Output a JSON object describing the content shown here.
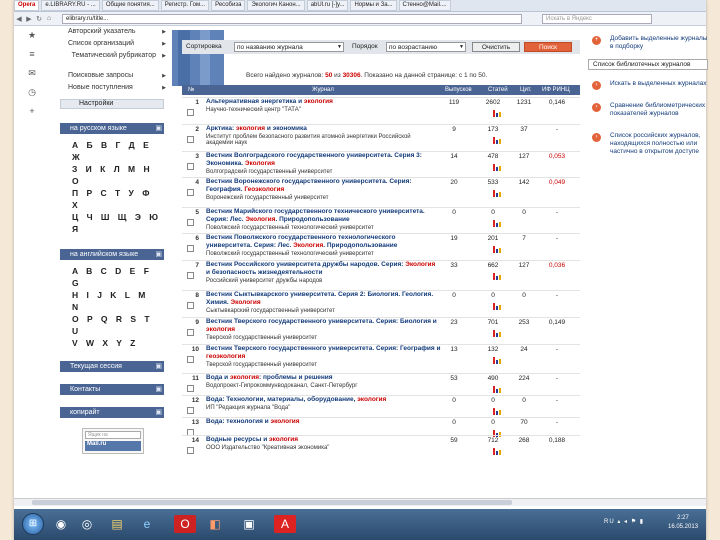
{
  "browser": {
    "tabs": [
      "Opera",
      "e.LIBRARY.RU - ...",
      "Общие понятия...",
      "Регистр. Гом...",
      "Ресобиза",
      "Экологич Канон...",
      "abUl.ru [-]у...",
      "Нормы и За...",
      "Стенно@Mail...."
    ],
    "url": "elibrary.ru/title...",
    "search_placeholder": "Искать в Яндекс"
  },
  "left_menu": {
    "items": [
      "Авторский указатель",
      "Список организаций",
      "Тематический рубрикатор",
      "Поисковые запросы",
      "Новые поступления"
    ],
    "settings": "Настройки",
    "russian_header": "на русском языке",
    "russian_letters": [
      "А Б В Г Д Е Ж",
      "З И К Л М Н О",
      "П Р С Т У Ф Х",
      "Ц Ч Ш Щ Э Ю Я"
    ],
    "english_header": "на английском языке",
    "english_letters": [
      "A B C D E F G",
      "H I J K L M N",
      "O P Q R S T U",
      "V W X Y Z"
    ],
    "current_session": "Текущая сессия",
    "contacts": "Контакты",
    "copyright": "копирайт",
    "mail_placeholder": "Ящик на",
    "mail_logo": "Mail.ru"
  },
  "sort_bar": {
    "sort_label": "Сортировка",
    "sort_value": "по названию журнала",
    "order_label": "Порядок",
    "order_value": "по возрастанию",
    "clear_button": "Очистить",
    "search_button": "Поиск"
  },
  "found": {
    "prefix": "Всего найдено журналов:",
    "count": "50",
    "from_word": "из",
    "total": "30306",
    "shown": "Показано на данной странице: с 1 по 50."
  },
  "table": {
    "headers": [
      "№",
      "Журнал",
      "Выпусков",
      "Статей",
      "Цит.",
      "ИФ РИНЦ"
    ],
    "rows": [
      {
        "num": "1",
        "title": "Альтернативная энергетика и экология",
        "org": "Научно-технический центр \"ТАТА\"",
        "issues": "119",
        "articles": "2602",
        "cit": "1231",
        "if": "0,146"
      },
      {
        "num": "2",
        "title": "Арктика: экология и экономика",
        "org": "Институт проблем безопасного развития атомной энергетики Российской академии наук",
        "issues": "9",
        "articles": "173",
        "cit": "37",
        "if": "-"
      },
      {
        "num": "3",
        "title": "Вестник Волгоградского государственного университета. Серия 3: Экономика. Экология",
        "org": "Волгоградский государственный университет",
        "issues": "14",
        "articles": "478",
        "cit": "127",
        "if": "0,053"
      },
      {
        "num": "4",
        "title": "Вестник Воронежского государственного университета. Серия: География. Геоэкология",
        "org": "Воронежский государственный университет",
        "issues": "20",
        "articles": "533",
        "cit": "142",
        "if": "0,049"
      },
      {
        "num": "5",
        "title": "Вестник Марийского государственного технического университета. Серия: Лес. Экология. Природопользование",
        "org": "Поволжский государственный технологический университет",
        "issues": "0",
        "articles": "0",
        "cit": "0",
        "if": "-"
      },
      {
        "num": "6",
        "title": "Вестник Поволжского государственного технологического университета. Серия: Лес. Экология. Природопользование",
        "org": "Поволжский государственный технологический университет",
        "issues": "19",
        "articles": "201",
        "cit": "7",
        "if": "-"
      },
      {
        "num": "7",
        "title": "Вестник Российского университета дружбы народов. Серия: Экология и безопасность жизнедеятельности",
        "org": "Российский университет дружбы народов",
        "issues": "33",
        "articles": "662",
        "cit": "127",
        "if": "0,036"
      },
      {
        "num": "8",
        "title": "Вестник Сыктывкарского университета. Серия 2: Биология. Геология. Химия. Экология",
        "org": "Сыктывкарский государственный университет",
        "issues": "0",
        "articles": "0",
        "cit": "0",
        "if": "-"
      },
      {
        "num": "9",
        "title": "Вестник Тверского государственного университета. Серия: Биология и экология",
        "org": "Тверской государственный университет",
        "issues": "23",
        "articles": "701",
        "cit": "253",
        "if": "0,149"
      },
      {
        "num": "10",
        "title": "Вестник Тверского государственного университета. Серия: География и геоэкология",
        "org": "Тверской государственный университет",
        "issues": "13",
        "articles": "132",
        "cit": "24",
        "if": "-"
      },
      {
        "num": "11",
        "title": "Вода и экология: проблемы и решения",
        "org": "Водопроект-Гипрокоммунводоканал, Санкт-Петербург",
        "issues": "53",
        "articles": "490",
        "cit": "224",
        "if": "-"
      },
      {
        "num": "12",
        "title": "Вода: Технологии, материалы, оборудование, экология",
        "org": "ИП \"Редакция журнала \"Вода\"",
        "issues": "0",
        "articles": "0",
        "cit": "0",
        "if": "-"
      },
      {
        "num": "13",
        "title": "Вода: технология и экология",
        "org": "",
        "issues": "0",
        "articles": "0",
        "cit": "70",
        "if": "-"
      },
      {
        "num": "14",
        "title": "Водные ресурсы и экология",
        "org": "ООО Издательство \"Креативная экономика\"",
        "issues": "59",
        "articles": "712",
        "cit": "268",
        "if": "0,188"
      }
    ]
  },
  "right_panel": {
    "add_selected": "Добавить выделенные журналы в подборку",
    "list_header": "Список библиотечных журналов",
    "search_selected": "Искать в выделенных журналах",
    "compare": "Сравнение библиометрических показателей журналов",
    "russian_list": "Список российских журналов, находящихся полностью или частично в открытом доступе"
  },
  "taskbar": {
    "tray_lang": "RU",
    "time": "2:27",
    "date": "16.05.2013"
  },
  "colors": {
    "header_blue": "#4a6593",
    "search_button": "#e2623a",
    "link_blue": "#123a7a",
    "highlight_red": "#cc0000"
  }
}
